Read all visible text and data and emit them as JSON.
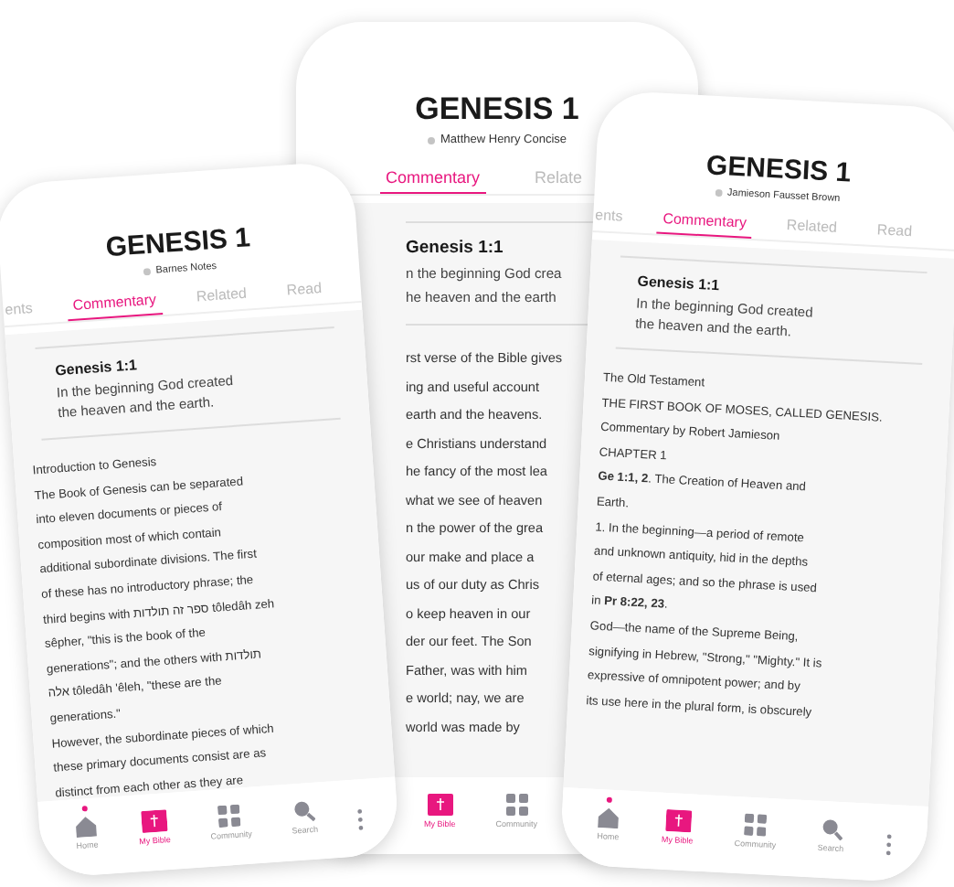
{
  "phones": [
    {
      "title": "GENESIS 1",
      "source": "Barnes Notes",
      "tabs": [
        {
          "label": "ents",
          "selected": false
        },
        {
          "label": "Commentary",
          "selected": true
        },
        {
          "label": "Related",
          "selected": false
        },
        {
          "label": "Read",
          "selected": false
        }
      ],
      "verse": {
        "ref": "Genesis 1:1",
        "lines": [
          "In the beginning God created",
          "the heaven and the earth."
        ]
      },
      "lines": [
        "Introduction to Genesis",
        "The Book of Genesis can be separated",
        "into eleven documents or pieces of",
        "composition most of which contain",
        "additional subordinate divisions. The first",
        "of these has no introductory phrase; the",
        "third begins with ספר זה תולדות tôledâh zeh",
        "sêpher, \"this is the book of the",
        "generations\"; and the others with תולדות",
        "אלה tôledâh 'êleh, \"these are the",
        "generations.\"",
        "However, the subordinate pieces of which",
        "these primary documents consist are as",
        "distinct from each other as they are"
      ],
      "nav": [
        {
          "kind": "home",
          "label": "Home",
          "selected": false,
          "dot": true
        },
        {
          "kind": "bible",
          "label": "My Bible",
          "selected": true,
          "dot": false
        },
        {
          "kind": "community",
          "label": "Community",
          "selected": false,
          "dot": false
        },
        {
          "kind": "search",
          "label": "Search",
          "selected": false,
          "dot": false
        }
      ],
      "more_menu": true
    },
    {
      "title": "GENESIS 1",
      "source": "Matthew Henry Concise",
      "tabs": [
        {
          "label": "Commentary",
          "selected": true
        },
        {
          "label": "Relate",
          "selected": false
        }
      ],
      "verse": {
        "ref": "Genesis 1:1",
        "lines": [
          "n the beginning God crea",
          "he heaven and the earth"
        ]
      },
      "lines": [
        "rst verse of the Bible gives",
        "ing and useful account",
        "earth and the heavens.",
        "e Christians understand",
        "he fancy of the most lea",
        "what we see of heaven",
        "n the power of the grea",
        "our make and place a",
        "us of our duty as Chris",
        "o keep heaven in our",
        "der our feet. The Son",
        "Father, was with him",
        "e world; nay, we are",
        "world was made by"
      ],
      "nav": [
        {
          "kind": "bible",
          "label": "My Bible",
          "selected": true,
          "dot": false
        },
        {
          "kind": "community",
          "label": "Community",
          "selected": false,
          "dot": false
        }
      ],
      "more_menu": false
    },
    {
      "title": "GENESIS 1",
      "source": "Jamieson Fausset Brown",
      "tabs": [
        {
          "label": "ents",
          "selected": false
        },
        {
          "label": "Commentary",
          "selected": true
        },
        {
          "label": "Related",
          "selected": false
        },
        {
          "label": "Read",
          "selected": false
        }
      ],
      "verse": {
        "ref": "Genesis 1:1",
        "lines": [
          "In the beginning God created",
          "the heaven and the earth."
        ]
      },
      "lines": [
        "The Old Testament",
        "THE FIRST BOOK OF MOSES, CALLED GENESIS.",
        "Commentary by Robert Jamieson",
        "CHAPTER 1",
        "**Ge 1:1, 2**. The Creation of Heaven and",
        "Earth.",
        "1. In the beginning—a period of remote",
        "and unknown antiquity, hid in the depths",
        "of eternal ages; and so the phrase is used",
        "in **Pr 8:22, 23**.",
        "God—the name of the Supreme Being,",
        "signifying in Hebrew, \"Strong,\" \"Mighty.\" It is",
        "expressive of omnipotent power; and by",
        "its use here in the plural form, is obscurely"
      ],
      "nav": [
        {
          "kind": "home",
          "label": "Home",
          "selected": false,
          "dot": true
        },
        {
          "kind": "bible",
          "label": "My Bible",
          "selected": true,
          "dot": false
        },
        {
          "kind": "community",
          "label": "Community",
          "selected": false,
          "dot": false
        },
        {
          "kind": "search",
          "label": "Search",
          "selected": false,
          "dot": false
        }
      ],
      "more_menu": true
    }
  ]
}
